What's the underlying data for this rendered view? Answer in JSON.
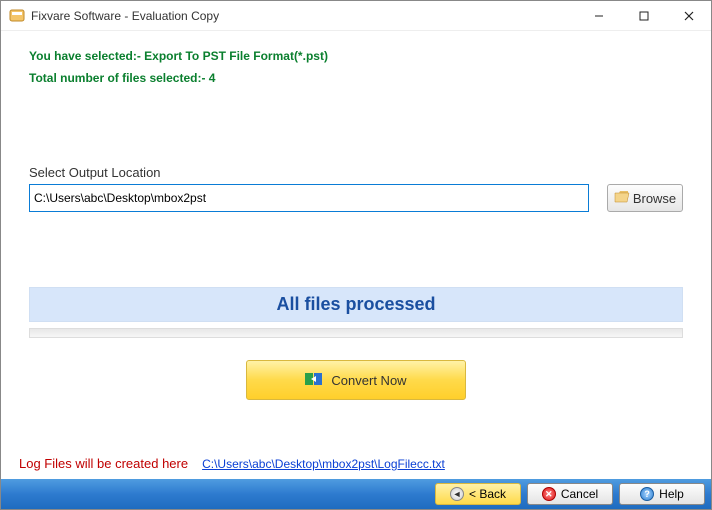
{
  "window": {
    "title": "Fixvare Software - Evaluation Copy"
  },
  "info": {
    "line1": "You have selected:- Export To PST File Format(*.pst)",
    "line2": "Total number of files selected:- 4"
  },
  "output": {
    "label": "Select Output Location",
    "path": "C:\\Users\\abc\\Desktop\\mbox2pst",
    "browse_label": "Browse"
  },
  "status": {
    "text": "All files processed"
  },
  "convert": {
    "label": "Convert Now"
  },
  "log": {
    "label": "Log Files will be created here",
    "link": "C:\\Users\\abc\\Desktop\\mbox2pst\\LogFilecc.txt"
  },
  "footer": {
    "back": "< Back",
    "cancel": "Cancel",
    "help": "Help"
  }
}
